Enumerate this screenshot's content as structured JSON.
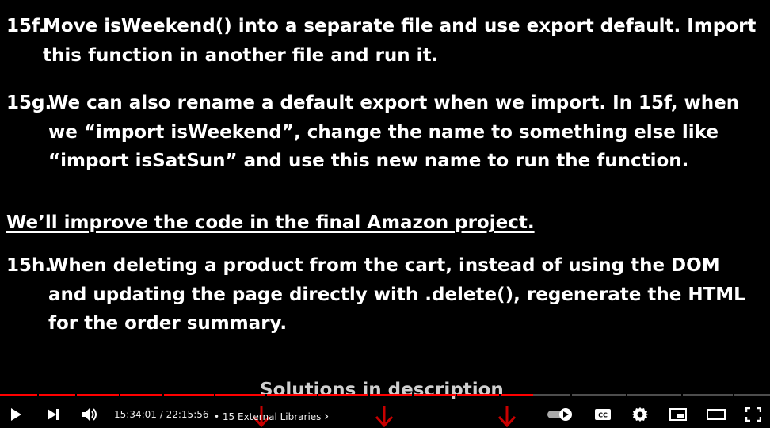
{
  "slide": {
    "items": [
      {
        "number": "15f.",
        "lines": [
          "Move isWeekend() into a separate file and use export default. Import",
          "this function in another file and run it."
        ]
      },
      {
        "number": "15g.",
        "lines": [
          "We can also rename a default export when we import. In 15f, when",
          "we “import isWeekend”, change the name to something else like",
          "“import isSatSun” and use this new name to run the function."
        ]
      },
      {
        "number": "15h.",
        "lines": [
          "When deleting a product from the cart, instead of using the DOM",
          "and updating the page directly with .delete(), regenerate the HTML",
          "for the order summary."
        ]
      }
    ],
    "note": "We’ll improve the code in the final Amazon project.",
    "solutions": "Solutions in description"
  },
  "player": {
    "progress_fraction": 0.6923,
    "current_time": "15:34:01",
    "duration": "22:15:56",
    "separator": "/",
    "bullet": "•",
    "chapter": "15 External Libraries",
    "chapter_chevron": "›",
    "colors": {
      "played": "#ff0000",
      "arrow": "#c80000"
    },
    "icons": [
      "play-icon",
      "next-icon",
      "volume-icon",
      "autoplay-toggle-icon",
      "captions-icon",
      "settings-icon",
      "miniplayer-icon",
      "theater-mode-icon",
      "fullscreen-icon"
    ]
  }
}
